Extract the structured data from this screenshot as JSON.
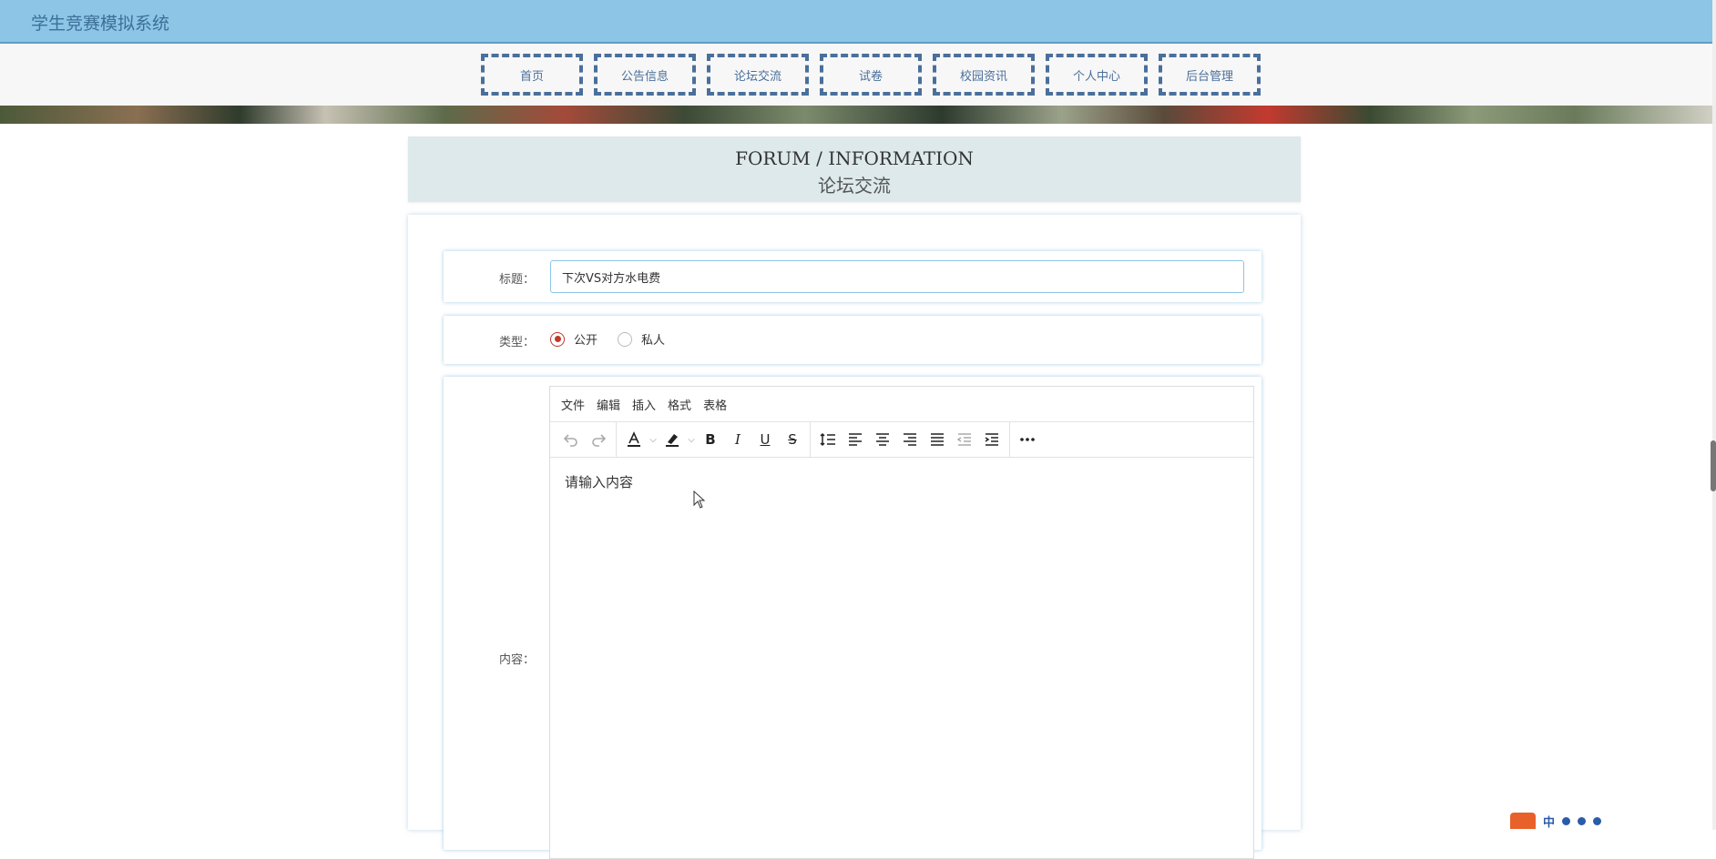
{
  "app": {
    "title": "学生竞赛模拟系统"
  },
  "nav": {
    "items": [
      {
        "label": "首页"
      },
      {
        "label": "公告信息"
      },
      {
        "label": "论坛交流"
      },
      {
        "label": "试卷"
      },
      {
        "label": "校园资讯"
      },
      {
        "label": "个人中心"
      },
      {
        "label": "后台管理"
      }
    ]
  },
  "page": {
    "heading_en": "FORUM / INFORMATION",
    "heading_zh": "论坛交流"
  },
  "form": {
    "title_label": "标题：",
    "title_value": "下次VS对方水电费",
    "type_label": "类型：",
    "type_options": [
      {
        "label": "公开",
        "checked": true
      },
      {
        "label": "私人",
        "checked": false
      }
    ],
    "content_label": "内容："
  },
  "editor": {
    "menus": [
      "文件",
      "编辑",
      "插入",
      "格式",
      "表格"
    ],
    "placeholder": "请输入内容",
    "toolbar_icons": [
      "undo-icon",
      "redo-icon",
      "text-color-icon",
      "highlight-icon",
      "bold-icon",
      "italic-icon",
      "underline-icon",
      "strikethrough-icon",
      "line-height-icon",
      "align-left-icon",
      "align-center-icon",
      "align-right-icon",
      "align-justify-icon",
      "outdent-icon",
      "indent-icon",
      "more-icon"
    ]
  },
  "tray": {
    "ime_label": "中"
  },
  "colors": {
    "topbar": "#8cc5e6",
    "nav_border": "#4a6f9a",
    "heading_bg": "#dde9ea",
    "radio_accent": "#c0392b"
  }
}
